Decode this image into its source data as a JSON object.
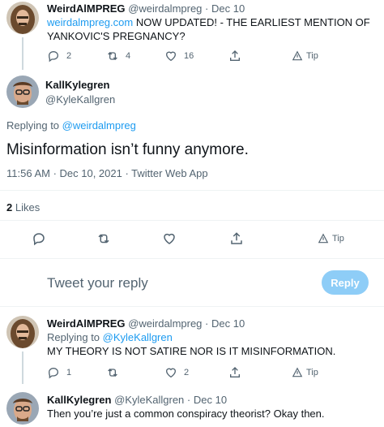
{
  "tweet1": {
    "display_name": "WeirdAlMPREG",
    "handle": "@weirdalmpreg",
    "sep": "·",
    "date": "Dec 10",
    "link_text": "weirdalmpreg.com",
    "text_line1": " NOW UPDATED! - THE EARLIEST MENTION OF",
    "text_line2": "YANKOVIC'S PREGNANCY?",
    "replies": "2",
    "retweets": "4",
    "likes": "16",
    "tip": "Tip"
  },
  "main": {
    "display_name": "KallKylegren",
    "handle": "@KyleKallgren",
    "replying_prefix": "Replying to ",
    "replying_handle": "@weirdalmpreg",
    "text": "Misinformation isn’t funny anymore.",
    "meta": "11:56 AM · Dec 10, 2021 · Twitter Web App",
    "likes_count": "2",
    "likes_label": " Likes",
    "tip": "Tip"
  },
  "composer": {
    "placeholder": "Tweet your reply",
    "button": "Reply"
  },
  "reply1": {
    "display_name": "WeirdAlMPREG",
    "handle": "@weirdalmpreg",
    "sep": "·",
    "date": "Dec 10",
    "replying_prefix": "Replying to ",
    "replying_handle": "@KyleKallgren",
    "text": "MY THEORY IS NOT SATIRE NOR IS IT MISINFORMATION.",
    "replies": "1",
    "retweets": "",
    "likes": "2",
    "tip": "Tip"
  },
  "reply2": {
    "display_name": "KallKylegren",
    "handle": "@KyleKallgren",
    "sep": "·",
    "date": "Dec 10",
    "text": "Then you’re just a common conspiracy theorist? Okay then."
  },
  "icons": {
    "reply": "reply-icon",
    "retweet": "retweet-icon",
    "like": "heart-icon",
    "share": "share-icon",
    "tip": "tip-icon"
  },
  "colors": {
    "link": "#1d9bf0",
    "muted": "#536471",
    "reply_button": "#8ecdf7"
  }
}
